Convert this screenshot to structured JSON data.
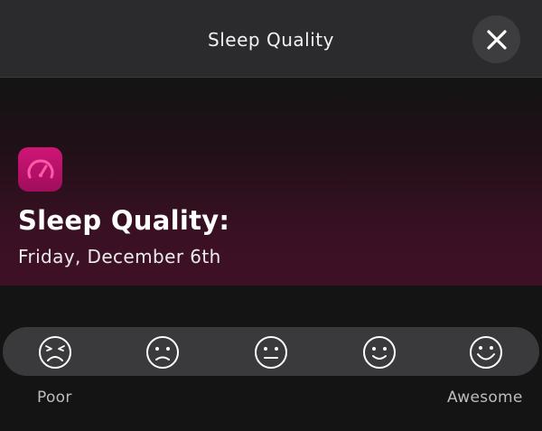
{
  "header": {
    "title": "Sleep Quality",
    "close_icon": "close-icon"
  },
  "hero": {
    "app_icon": "speedometer-icon",
    "title": "Sleep Quality:",
    "date": "Friday, December 6th"
  },
  "rating": {
    "options": [
      {
        "icon": "face-very-sad-icon"
      },
      {
        "icon": "face-sad-icon"
      },
      {
        "icon": "face-neutral-icon"
      },
      {
        "icon": "face-smile-icon"
      },
      {
        "icon": "face-happy-icon"
      }
    ],
    "min_label": "Poor",
    "max_label": "Awesome"
  },
  "colors": {
    "accent": "#cf1577",
    "background": "#141414",
    "header": "#2b2b2d",
    "rating_bar": "#3a3a3c"
  }
}
